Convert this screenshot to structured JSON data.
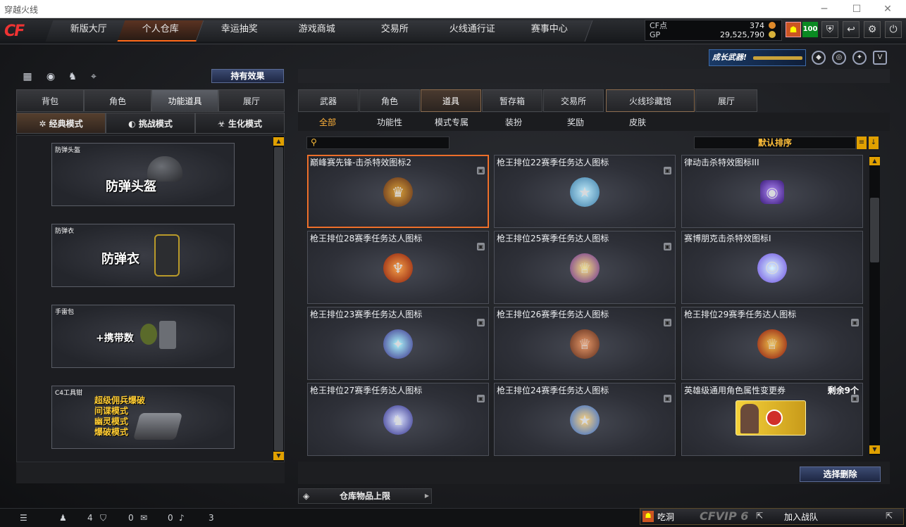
{
  "window": {
    "title": "穿越火线"
  },
  "nav": {
    "logo": "CF",
    "tabs": [
      {
        "label": "新版大厅"
      },
      {
        "label": "个人仓库"
      },
      {
        "label": "幸运抽奖"
      },
      {
        "label": "游戏商城"
      },
      {
        "label": "交易所"
      },
      {
        "label": "火线通行证"
      },
      {
        "label": "赛事中心"
      }
    ]
  },
  "currency": {
    "cf_label": "CF点",
    "cf_value": "374",
    "gp_label": "GP",
    "gp_value": "29,525,790"
  },
  "user": {
    "level": "100"
  },
  "promo": {
    "banner": "成长武器!"
  },
  "left": {
    "effects_button": "持有效果",
    "tabs": [
      {
        "label": "背包"
      },
      {
        "label": "角色"
      },
      {
        "label": "功能道具"
      },
      {
        "label": "展厅"
      }
    ],
    "modes": [
      {
        "label": "经典模式"
      },
      {
        "label": "挑战模式"
      },
      {
        "label": "生化模式"
      }
    ],
    "cards": [
      {
        "corner": "防弹头盔",
        "title": "防弹头盔",
        "lines": []
      },
      {
        "corner": "防弹衣",
        "title": "防弹衣",
        "lines": []
      },
      {
        "corner": "手雷包",
        "title": "+携带数",
        "lines": []
      },
      {
        "corner": "C4工具钳",
        "title": "",
        "lines": [
          "超级佣兵爆破",
          "间谍模式",
          "幽灵模式",
          "爆破模式"
        ]
      }
    ]
  },
  "right": {
    "tabs": [
      {
        "label": "武器"
      },
      {
        "label": "角色"
      },
      {
        "label": "道具"
      },
      {
        "label": "暂存箱"
      },
      {
        "label": "交易所"
      },
      {
        "label": "火线珍藏馆"
      },
      {
        "label": "展厅"
      }
    ],
    "subtabs": [
      {
        "label": "全部"
      },
      {
        "label": "功能性"
      },
      {
        "label": "模式专属"
      },
      {
        "label": "装扮"
      },
      {
        "label": "奖励"
      },
      {
        "label": "皮肤"
      }
    ],
    "sort_label": "默认排序",
    "items": [
      {
        "name": "巅峰赛先锋-击杀特效图标2",
        "icon": "trophy-crest-icon",
        "color": "#d9a13a",
        "count": ""
      },
      {
        "name": "枪王排位22赛季任务达人图标",
        "icon": "star-medal-icon",
        "color": "#7cc6e8",
        "count": ""
      },
      {
        "name": "律动击杀特效图标III",
        "icon": "speaker-icon",
        "color": "#8a5cf0",
        "count": ""
      },
      {
        "name": "枪王排位28赛季任务达人图标",
        "icon": "flame-shield-icon",
        "color": "#e2552a",
        "count": ""
      },
      {
        "name": "枪王排位25赛季任务达人图标",
        "icon": "rainbow-trophy-icon",
        "color": "#c8a0ff",
        "count": ""
      },
      {
        "name": "赛博朋克击杀特效图标I",
        "icon": "cat-mask-icon",
        "color": "#6fd8ff",
        "count": ""
      },
      {
        "name": "枪王排位23赛季任务达人图标",
        "icon": "crystal-star-icon",
        "color": "#70e0e8",
        "count": ""
      },
      {
        "name": "枪王排位26赛季任务达人图标",
        "icon": "bronze-trophy-icon",
        "color": "#c76d3a",
        "count": ""
      },
      {
        "name": "枪王排位29赛季任务达人图标",
        "icon": "red-gold-trophy-icon",
        "color": "#b8221f",
        "count": ""
      },
      {
        "name": "枪王排位27赛季任务达人图标",
        "icon": "wolf-shield-icon",
        "color": "#5a6ad8",
        "count": ""
      },
      {
        "name": "枪王排位24赛季任务达人图标",
        "icon": "fire-ice-medal-icon",
        "color": "#e58a2a",
        "count": ""
      },
      {
        "name": "英雄级通用角色属性变更券",
        "icon": "hero-ticket-icon",
        "color": "#e5c23a",
        "count": "剩余9个"
      }
    ],
    "delete_button": "选择删除",
    "limit_label": "仓库物品上限"
  },
  "status": {
    "friends": "4",
    "shield": "0",
    "chat": "0",
    "volume": "3",
    "chat_label": "吃洞",
    "vip": "CFVIP 6",
    "join": "加入战队"
  }
}
